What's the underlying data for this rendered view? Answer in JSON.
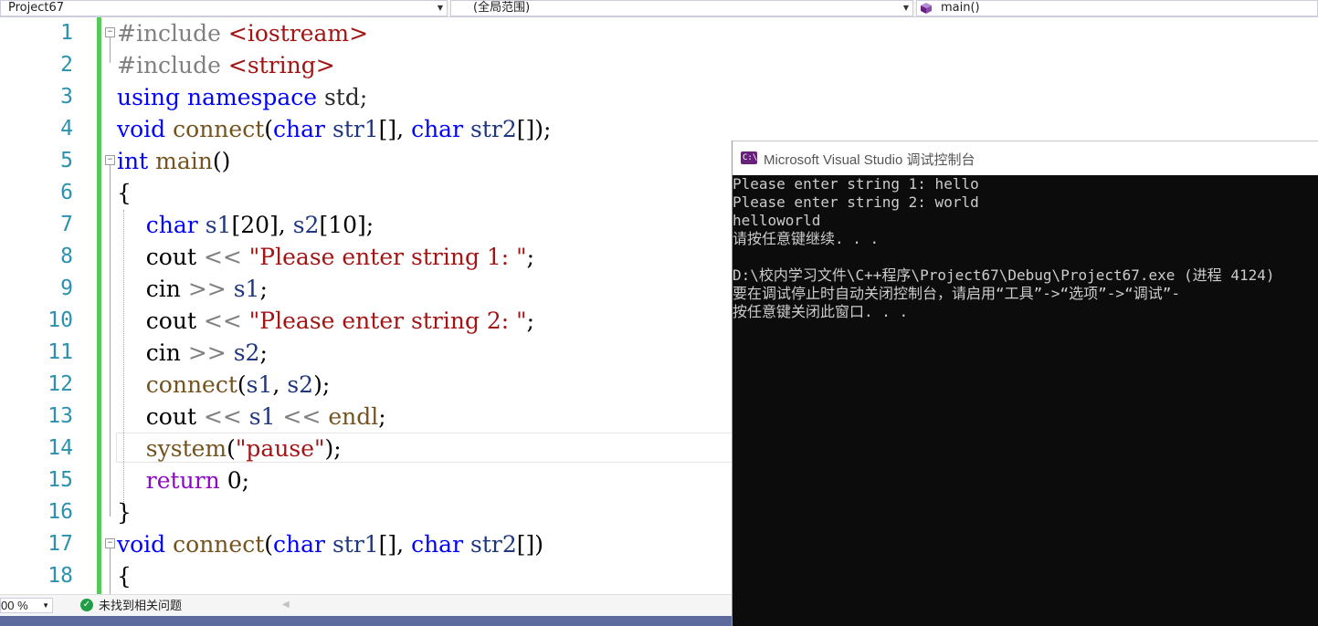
{
  "navbar": {
    "project": "Project67",
    "scope": "(全局范围)",
    "member": "main()"
  },
  "editor": {
    "line_numbers": [
      "1",
      "2",
      "3",
      "4",
      "5",
      "6",
      "7",
      "8",
      "9",
      "10",
      "11",
      "12",
      "13",
      "14",
      "15",
      "16",
      "17",
      "18"
    ],
    "lines": [
      [
        {
          "t": "#include ",
          "c": "inc"
        },
        {
          "t": "<iostream>",
          "c": "incf"
        }
      ],
      [
        {
          "t": "#include ",
          "c": "inc"
        },
        {
          "t": "<string>",
          "c": "incf"
        }
      ],
      [
        {
          "t": "using",
          "c": "kw"
        },
        {
          "t": " ",
          "c": ""
        },
        {
          "t": "namespace",
          "c": "kw"
        },
        {
          "t": " std;",
          "c": "ns"
        }
      ],
      [
        {
          "t": "void",
          "c": "kw"
        },
        {
          "t": " ",
          "c": ""
        },
        {
          "t": "connect",
          "c": "fn"
        },
        {
          "t": "(",
          "c": ""
        },
        {
          "t": "char",
          "c": "kw"
        },
        {
          "t": " ",
          "c": ""
        },
        {
          "t": "str1",
          "c": "id"
        },
        {
          "t": "[], ",
          "c": ""
        },
        {
          "t": "char",
          "c": "kw"
        },
        {
          "t": " ",
          "c": ""
        },
        {
          "t": "str2",
          "c": "id"
        },
        {
          "t": "[]);",
          "c": ""
        }
      ],
      [
        {
          "t": "int",
          "c": "kw"
        },
        {
          "t": " ",
          "c": ""
        },
        {
          "t": "main",
          "c": "fn"
        },
        {
          "t": "()",
          "c": ""
        }
      ],
      [
        {
          "t": "{",
          "c": ""
        }
      ],
      [
        {
          "t": "    ",
          "c": ""
        },
        {
          "t": "char",
          "c": "kw"
        },
        {
          "t": " ",
          "c": ""
        },
        {
          "t": "s1",
          "c": "id"
        },
        {
          "t": "[20], ",
          "c": ""
        },
        {
          "t": "s2",
          "c": "id"
        },
        {
          "t": "[10];",
          "c": ""
        }
      ],
      [
        {
          "t": "    cout ",
          "c": ""
        },
        {
          "t": "<<",
          "c": "inc"
        },
        {
          "t": " ",
          "c": ""
        },
        {
          "t": "\"Please enter string 1: \"",
          "c": "str"
        },
        {
          "t": ";",
          "c": ""
        }
      ],
      [
        {
          "t": "    cin ",
          "c": ""
        },
        {
          "t": ">>",
          "c": "inc"
        },
        {
          "t": " ",
          "c": ""
        },
        {
          "t": "s1",
          "c": "id"
        },
        {
          "t": ";",
          "c": ""
        }
      ],
      [
        {
          "t": "    cout ",
          "c": ""
        },
        {
          "t": "<<",
          "c": "inc"
        },
        {
          "t": " ",
          "c": ""
        },
        {
          "t": "\"Please enter string 2: \"",
          "c": "str"
        },
        {
          "t": ";",
          "c": ""
        }
      ],
      [
        {
          "t": "    cin ",
          "c": ""
        },
        {
          "t": ">>",
          "c": "inc"
        },
        {
          "t": " ",
          "c": ""
        },
        {
          "t": "s2",
          "c": "id"
        },
        {
          "t": ";",
          "c": ""
        }
      ],
      [
        {
          "t": "    ",
          "c": ""
        },
        {
          "t": "connect",
          "c": "fn"
        },
        {
          "t": "(",
          "c": ""
        },
        {
          "t": "s1",
          "c": "id"
        },
        {
          "t": ", ",
          "c": ""
        },
        {
          "t": "s2",
          "c": "id"
        },
        {
          "t": ");",
          "c": ""
        }
      ],
      [
        {
          "t": "    cout ",
          "c": ""
        },
        {
          "t": "<<",
          "c": "inc"
        },
        {
          "t": " ",
          "c": ""
        },
        {
          "t": "s1",
          "c": "id"
        },
        {
          "t": " ",
          "c": ""
        },
        {
          "t": "<<",
          "c": "inc"
        },
        {
          "t": " ",
          "c": ""
        },
        {
          "t": "endl",
          "c": "fn"
        },
        {
          "t": ";",
          "c": ""
        }
      ],
      [
        {
          "t": "    ",
          "c": ""
        },
        {
          "t": "system",
          "c": "fn"
        },
        {
          "t": "(",
          "c": ""
        },
        {
          "t": "\"pause\"",
          "c": "str"
        },
        {
          "t": ");",
          "c": ""
        }
      ],
      [
        {
          "t": "    ",
          "c": ""
        },
        {
          "t": "return",
          "c": "ret"
        },
        {
          "t": " 0;",
          "c": ""
        }
      ],
      [
        {
          "t": "}",
          "c": ""
        }
      ],
      [
        {
          "t": "void",
          "c": "kw"
        },
        {
          "t": " ",
          "c": ""
        },
        {
          "t": "connect",
          "c": "fn"
        },
        {
          "t": "(",
          "c": ""
        },
        {
          "t": "char",
          "c": "kw"
        },
        {
          "t": " ",
          "c": ""
        },
        {
          "t": "str1",
          "c": "id"
        },
        {
          "t": "[], ",
          "c": ""
        },
        {
          "t": "char",
          "c": "kw"
        },
        {
          "t": " ",
          "c": ""
        },
        {
          "t": "str2",
          "c": "id"
        },
        {
          "t": "[])",
          "c": ""
        }
      ],
      [
        {
          "t": "{",
          "c": ""
        }
      ]
    ]
  },
  "console": {
    "title": "Microsoft Visual Studio 调试控制台",
    "icon_glyph": "C:\\",
    "lines": [
      "Please enter string 1: hello",
      "Please enter string 2: world",
      "helloworld",
      "请按任意键继续. . .",
      "",
      "D:\\校内学习文件\\C++程序\\Project67\\Debug\\Project67.exe (进程 4124)",
      "要在调试停止时自动关闭控制台，请启用“工具”->“选项”->“调试”-",
      "按任意键关闭此窗口. . ."
    ]
  },
  "statusbar": {
    "zoom": "00 %",
    "issues": "未找到相关问题"
  },
  "colors": {
    "keyword": "#0000ff",
    "function": "#74531f",
    "string": "#a31515",
    "line_number": "#2b91af",
    "change_bar": "#57c957",
    "console_bg": "#0c0c0c"
  }
}
